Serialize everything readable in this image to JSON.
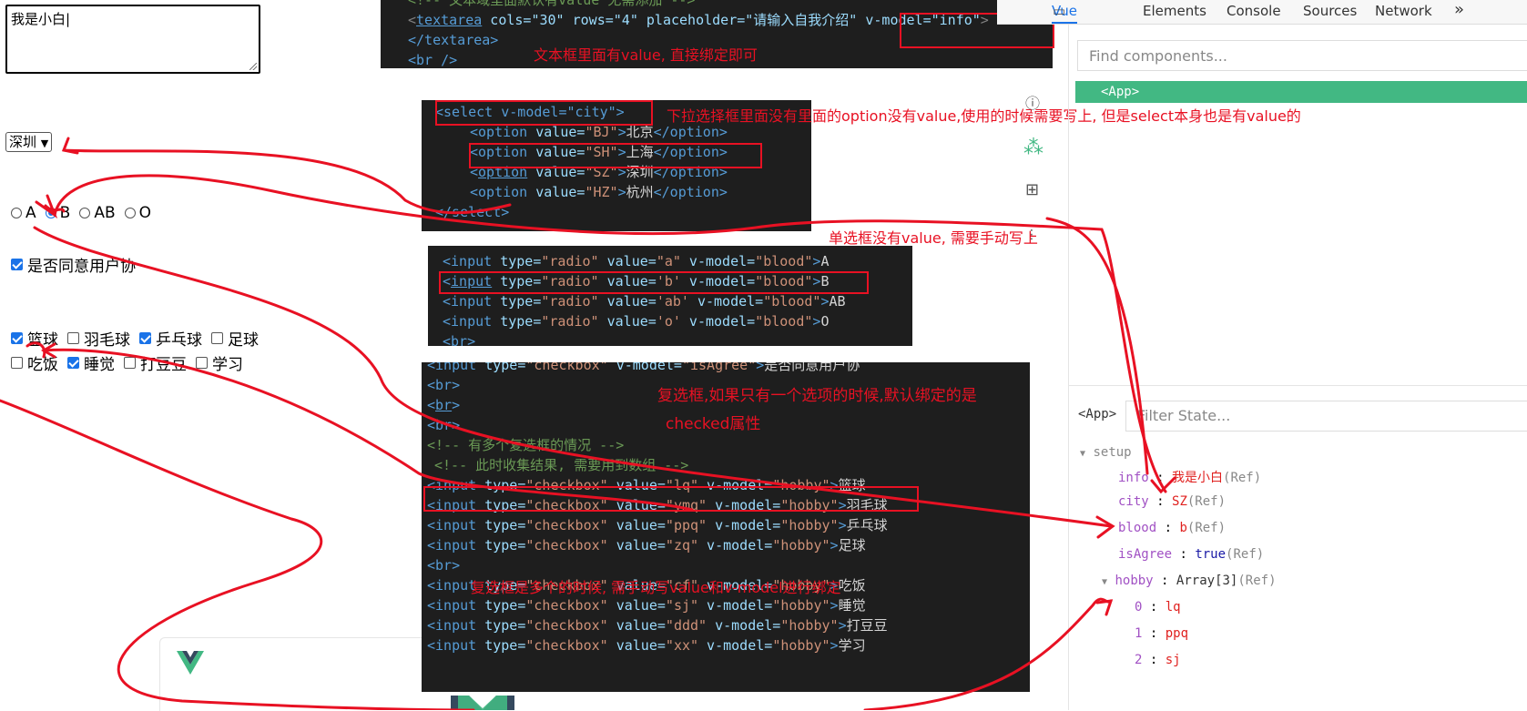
{
  "form": {
    "textarea_value": "我是小白|",
    "select_value": "深圳",
    "radios": [
      {
        "label": "A",
        "checked": false
      },
      {
        "label": "B",
        "checked": true
      },
      {
        "label": "AB",
        "checked": false
      },
      {
        "label": "O",
        "checked": false
      }
    ],
    "agree_label": "是否同意用户协",
    "agree_checked": true,
    "hobbies_row1": [
      {
        "label": "篮球",
        "checked": true
      },
      {
        "label": "羽毛球",
        "checked": false
      },
      {
        "label": "乒乓球",
        "checked": true
      },
      {
        "label": "足球",
        "checked": false
      }
    ],
    "hobbies_row2": [
      {
        "label": "吃饭",
        "checked": false
      },
      {
        "label": "睡觉",
        "checked": true
      },
      {
        "label": "打豆豆",
        "checked": false
      },
      {
        "label": "学习",
        "checked": false
      }
    ]
  },
  "notes": {
    "textarea": "文本框里面有value, 直接绑定即可",
    "select": "下拉选择框里面没有里面的option没有value,使用的时候需要写上, 但是select本身也是有value的",
    "radio": "单选框没有value, 需要手动写上",
    "checkbox_single_1": "复选框,如果只有一个选项的时候,默认绑定的是",
    "checkbox_single_2": "checked属性",
    "checkbox_multi": "复选框是多个的时候, 需手动写value和v-model进行绑定"
  },
  "code1": {
    "comment": "<!-- 文本域里面默认有value 无需添加 -->",
    "line1_attrs": " cols=\"30\" rows=\"4\" placeholder=\"请输入自我介绍\" ",
    "vmodel": "v-model=\"info\"",
    "line2": "</textarea>",
    "line3": "<br />"
  },
  "code2": {
    "select_open": "<select v-model=\"city\">",
    "options": [
      {
        "value": "BJ",
        "text": "北京"
      },
      {
        "value": "SH",
        "text": "上海"
      },
      {
        "value": "SZ",
        "text": "深圳"
      },
      {
        "value": "HZ",
        "text": "杭州"
      }
    ],
    "select_close": "</select>"
  },
  "code3": {
    "lines": [
      {
        "value": "\"a\"",
        "label": "A"
      },
      {
        "value": "'b'",
        "label": "B"
      },
      {
        "value": "'ab'",
        "label": "AB"
      },
      {
        "value": "'o'",
        "label": "O"
      }
    ],
    "tail": "<br>"
  },
  "code4": {
    "agree_line_label": "是否同意用户协",
    "comment1": "<!-- 有多个复选框的情况 -->",
    "comment2": "<!-- 此时收集结果, 需要用到数组 -->",
    "hobby_lines1": [
      {
        "value": "lq",
        "label": "篮球"
      },
      {
        "value": "ymq",
        "label": "羽毛球"
      },
      {
        "value": "ppq",
        "label": "乒乓球"
      },
      {
        "value": "zq",
        "label": "足球"
      }
    ],
    "hobby_lines2": [
      {
        "value": "cf",
        "label": "吃饭"
      },
      {
        "value": "sj",
        "label": "睡觉"
      },
      {
        "value": "ddd",
        "label": "打豆豆"
      },
      {
        "value": "xx",
        "label": "学习"
      }
    ]
  },
  "devtools": {
    "tabs": [
      "Vue",
      "Elements",
      "Console",
      "Sources",
      "Network",
      "»"
    ],
    "find_placeholder": "Find components...",
    "app_tag": "<App>",
    "app_label": "<App>",
    "filter_placeholder": "Filter State...",
    "setup_label": "setup",
    "state": [
      {
        "key": "info",
        "value": "我是小白",
        "ref": "(Ref)"
      },
      {
        "key": "city",
        "value": "SZ",
        "ref": "(Ref)"
      },
      {
        "key": "blood",
        "value": "b",
        "ref": "(Ref)"
      },
      {
        "key": "isAgree",
        "value": "true",
        "ref": "(Ref)"
      },
      {
        "key": "hobby",
        "value": "Array[3]",
        "ref": "(Ref)"
      }
    ],
    "hobby_items": [
      {
        "index": "0",
        "value": "lq"
      },
      {
        "index": "1",
        "value": "ppq"
      },
      {
        "index": "2",
        "value": "sj"
      }
    ]
  },
  "colors": {
    "accent": "#42b883",
    "annotation": "#e81123",
    "code_bg": "#1e1e1e"
  }
}
